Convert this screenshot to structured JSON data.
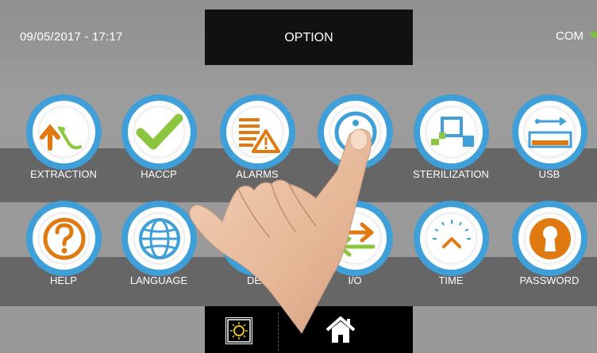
{
  "header": {
    "datetime": "09/05/2017 - 17:17",
    "title": "OPTION",
    "com_label": "COM",
    "com_status_color": "#7bc043"
  },
  "tiles": [
    {
      "label": "EXTRACTION",
      "icon": "extraction-icon"
    },
    {
      "label": "HACCP",
      "icon": "checkmark-icon"
    },
    {
      "label": "ALARMS",
      "icon": "alarm-warning-icon"
    },
    {
      "label": "",
      "icon": "info-icon"
    },
    {
      "label": "STERILIZATION",
      "icon": "sterilization-icon"
    },
    {
      "label": "USB",
      "icon": "usb-icon"
    },
    {
      "label": "HELP",
      "icon": "help-icon"
    },
    {
      "label": "LANGUAGE",
      "icon": "globe-icon"
    },
    {
      "label": "DEF",
      "icon": "defrost-icon"
    },
    {
      "label": "I/O",
      "icon": "io-arrows-icon"
    },
    {
      "label": "TIME",
      "icon": "clock-icon"
    },
    {
      "label": "PASSWORD",
      "icon": "keyhole-icon"
    }
  ],
  "bottom_bar": {
    "brightness_icon": "brightness-icon",
    "home_icon": "home-icon"
  },
  "colors": {
    "ring_blue": "#3f9fd8",
    "accent_orange": "#e07a10",
    "accent_green": "#8cc63f"
  }
}
